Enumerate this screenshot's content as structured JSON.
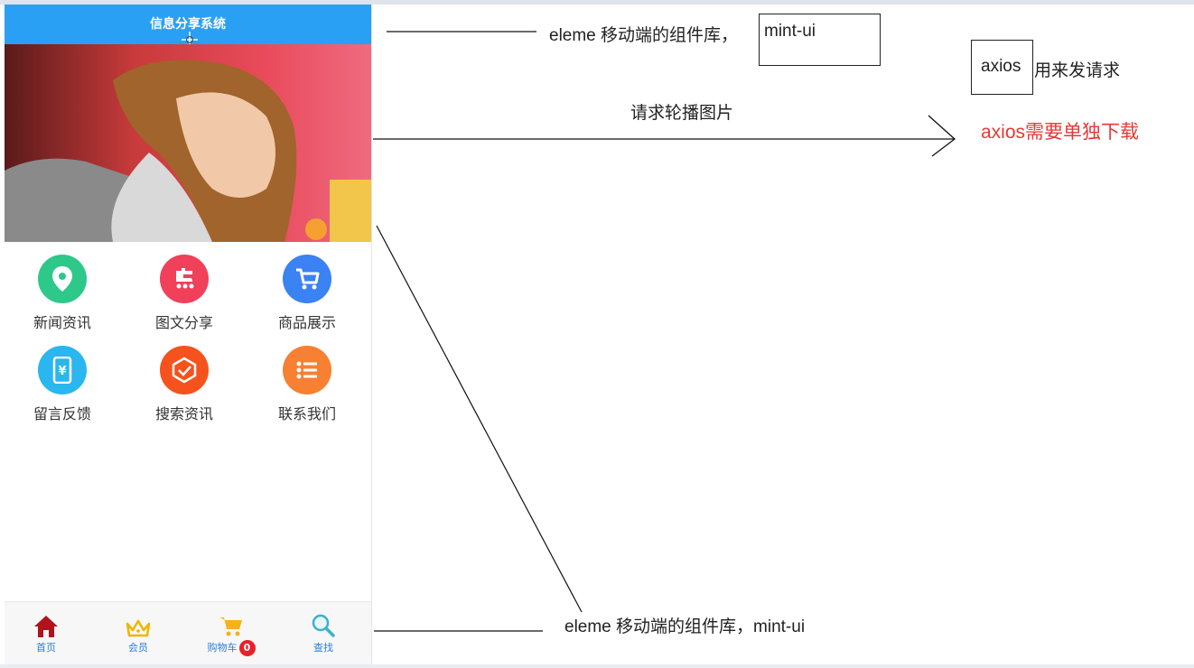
{
  "phone": {
    "header_title": "信息分享系统",
    "grid": [
      {
        "label": "新闻资讯",
        "color": "#2dc88a",
        "icon": "location-pin-icon"
      },
      {
        "label": "图文分享",
        "color": "#f0405a",
        "icon": "share-dot-icon"
      },
      {
        "label": "商品展示",
        "color": "#3b82f2",
        "icon": "cart-icon"
      },
      {
        "label": "留言反馈",
        "color": "#2ab6ee",
        "icon": "phone-yen-icon"
      },
      {
        "label": "搜索资讯",
        "color": "#f5521d",
        "icon": "check-shield-icon"
      },
      {
        "label": "联系我们",
        "color": "#f78032",
        "icon": "list-icon"
      }
    ],
    "tabs": [
      {
        "label": "首页",
        "icon": "home-icon"
      },
      {
        "label": "会员",
        "icon": "crown-icon"
      },
      {
        "label": "购物车",
        "icon": "cart-icon",
        "badge": "0"
      },
      {
        "label": "查找",
        "icon": "search-icon"
      }
    ]
  },
  "annotations": {
    "top_note": "eleme 移动端的组件库，",
    "top_note_box": "mint-ui",
    "axios_box": "axios",
    "axios_note": "用来发请求",
    "carousel_note": "请求轮播图片",
    "axios_download": "axios需要单独下载",
    "bottom_note": "eleme 移动端的组件库，mint-ui"
  }
}
